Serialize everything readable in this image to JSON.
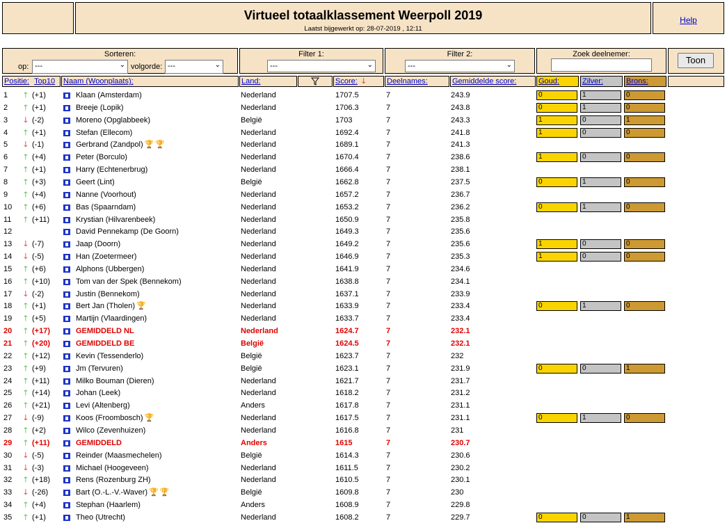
{
  "header": {
    "title": "Virtueel totaalklassement Weerpoll 2019",
    "updated": "Laatst bijgewerkt op: 28-07-2019 , 12:11",
    "help_label": "Help"
  },
  "controls": {
    "sort_label": "Sorteren:",
    "op_label": "op:",
    "op_value": "---",
    "order_label": "volgorde:",
    "order_value": "---",
    "filter1_label": "Filter 1:",
    "filter1_value": "---",
    "filter2_label": "Filter 2:",
    "filter2_value": "---",
    "search_label": "Zoek deelnemer:",
    "search_value": "",
    "show_button": "Toon"
  },
  "columns": {
    "positie": "Positie:",
    "top10": "Top10",
    "naam": "Naam (Woonplaats):",
    "land": "Land:",
    "score": "Score:",
    "deelnames": "Deelnames:",
    "gemiddelde": "Gemiddelde score:",
    "goud": "Goud:",
    "zilver": "Zilver:",
    "brons": "Brons:"
  },
  "colors": {
    "gold": "#f9d400",
    "silver": "#c4c4c4",
    "bronze": "#cc9933",
    "header_bg": "#f6e3c6",
    "up": "#1db31d",
    "down": "#e00000"
  },
  "rows": [
    {
      "pos": "1",
      "dir": "up",
      "chg": "(+1)",
      "name": "Klaan (Amsterdam)",
      "land": "Nederland",
      "score": "1707.5",
      "deel": "7",
      "avg": "243.9",
      "medals": [
        "0",
        "1",
        "0"
      ]
    },
    {
      "pos": "2",
      "dir": "up",
      "chg": "(+1)",
      "name": "Breeje (Lopik)",
      "land": "Nederland",
      "score": "1706.3",
      "deel": "7",
      "avg": "243.8",
      "medals": [
        "0",
        "1",
        "0"
      ]
    },
    {
      "pos": "3",
      "dir": "down",
      "chg": "(-2)",
      "name": "Moreno (Opglabbeek)",
      "land": "België",
      "score": "1703",
      "deel": "7",
      "avg": "243.3",
      "medals": [
        "1",
        "0",
        "1"
      ]
    },
    {
      "pos": "4",
      "dir": "up",
      "chg": "(+1)",
      "name": "Stefan (Ellecom)",
      "land": "Nederland",
      "score": "1692.4",
      "deel": "7",
      "avg": "241.8",
      "medals": [
        "1",
        "0",
        "0"
      ]
    },
    {
      "pos": "5",
      "dir": "down",
      "chg": "(-1)",
      "name": "Gerbrand (Zandpol)",
      "land": "Nederland",
      "score": "1689.1",
      "deel": "7",
      "avg": "241.3",
      "trophies": "bb"
    },
    {
      "pos": "6",
      "dir": "up",
      "chg": "(+4)",
      "name": "Peter (Borculo)",
      "land": "Nederland",
      "score": "1670.4",
      "deel": "7",
      "avg": "238.6",
      "medals": [
        "1",
        "0",
        "0"
      ]
    },
    {
      "pos": "7",
      "dir": "up",
      "chg": "(+1)",
      "name": "Harry (Echtenerbrug)",
      "land": "Nederland",
      "score": "1666.4",
      "deel": "7",
      "avg": "238.1"
    },
    {
      "pos": "8",
      "dir": "up",
      "chg": "(+3)",
      "name": "Geert (Lint)",
      "land": "België",
      "score": "1662.8",
      "deel": "7",
      "avg": "237.5",
      "medals": [
        "0",
        "1",
        "0"
      ]
    },
    {
      "pos": "9",
      "dir": "up",
      "chg": "(+4)",
      "name": "Nanne (Voorhout)",
      "land": "Nederland",
      "score": "1657.2",
      "deel": "7",
      "avg": "236.7"
    },
    {
      "pos": "10",
      "dir": "up",
      "chg": "(+6)",
      "name": "Bas (Spaarndam)",
      "land": "Nederland",
      "score": "1653.2",
      "deel": "7",
      "avg": "236.2",
      "medals": [
        "0",
        "1",
        "0"
      ]
    },
    {
      "pos": "11",
      "dir": "up",
      "chg": "(+11)",
      "name": "Krystian (Hilvarenbeek)",
      "land": "Nederland",
      "score": "1650.9",
      "deel": "7",
      "avg": "235.8"
    },
    {
      "pos": "12",
      "dir": "",
      "chg": "",
      "name": "David Pennekamp (De Goorn)",
      "land": "Nederland",
      "score": "1649.3",
      "deel": "7",
      "avg": "235.6"
    },
    {
      "pos": "13",
      "dir": "down",
      "chg": "(-7)",
      "name": "Jaap (Doorn)",
      "land": "Nederland",
      "score": "1649.2",
      "deel": "7",
      "avg": "235.6",
      "medals": [
        "1",
        "0",
        "0"
      ]
    },
    {
      "pos": "14",
      "dir": "down",
      "chg": "(-5)",
      "name": "Han (Zoetermeer)",
      "land": "Nederland",
      "score": "1646.9",
      "deel": "7",
      "avg": "235.3",
      "medals": [
        "1",
        "0",
        "0"
      ]
    },
    {
      "pos": "15",
      "dir": "up",
      "chg": "(+6)",
      "name": "Alphons (Ubbergen)",
      "land": "Nederland",
      "score": "1641.9",
      "deel": "7",
      "avg": "234.6"
    },
    {
      "pos": "16",
      "dir": "up",
      "chg": "(+10)",
      "name": "Tom van der Spek (Bennekom)",
      "land": "Nederland",
      "score": "1638.8",
      "deel": "7",
      "avg": "234.1"
    },
    {
      "pos": "17",
      "dir": "down",
      "chg": "(-2)",
      "name": "Justin (Bennekom)",
      "land": "Nederland",
      "score": "1637.1",
      "deel": "7",
      "avg": "233.9"
    },
    {
      "pos": "18",
      "dir": "up",
      "chg": "(+1)",
      "name": "Bert Jan (Tholen)",
      "land": "Nederland",
      "score": "1633.9",
      "deel": "7",
      "avg": "233.4",
      "medals": [
        "0",
        "1",
        "0"
      ],
      "trophies": "b"
    },
    {
      "pos": "19",
      "dir": "up",
      "chg": "(+5)",
      "name": "Martijn (Vlaardingen)",
      "land": "Nederland",
      "score": "1633.7",
      "deel": "7",
      "avg": "233.4"
    },
    {
      "pos": "20",
      "dir": "up",
      "chg": "(+17)",
      "name": "GEMIDDELD NL",
      "land": "Nederland",
      "score": "1624.7",
      "deel": "7",
      "avg": "232.1",
      "special": true
    },
    {
      "pos": "21",
      "dir": "up",
      "chg": "(+20)",
      "name": "GEMIDDELD BE",
      "land": "België",
      "score": "1624.5",
      "deel": "7",
      "avg": "232.1",
      "special": true
    },
    {
      "pos": "22",
      "dir": "up",
      "chg": "(+12)",
      "name": "Kevin (Tessenderlo)",
      "land": "België",
      "score": "1623.7",
      "deel": "7",
      "avg": "232"
    },
    {
      "pos": "23",
      "dir": "up",
      "chg": "(+9)",
      "name": "Jm (Tervuren)",
      "land": "België",
      "score": "1623.1",
      "deel": "7",
      "avg": "231.9",
      "medals": [
        "0",
        "0",
        "1"
      ]
    },
    {
      "pos": "24",
      "dir": "up",
      "chg": "(+11)",
      "name": "Milko Bouman (Dieren)",
      "land": "Nederland",
      "score": "1621.7",
      "deel": "7",
      "avg": "231.7"
    },
    {
      "pos": "25",
      "dir": "up",
      "chg": "(+14)",
      "name": "Johan (Leek)",
      "land": "Nederland",
      "score": "1618.2",
      "deel": "7",
      "avg": "231.2"
    },
    {
      "pos": "26",
      "dir": "up",
      "chg": "(+21)",
      "name": "Levi (Altenberg)",
      "land": "Anders",
      "score": "1617.8",
      "deel": "7",
      "avg": "231.1"
    },
    {
      "pos": "27",
      "dir": "down",
      "chg": "(-9)",
      "name": "Koos (Froombosch)",
      "land": "Nederland",
      "score": "1617.5",
      "deel": "7",
      "avg": "231.1",
      "medals": [
        "0",
        "1",
        "0"
      ],
      "trophies": "g"
    },
    {
      "pos": "28",
      "dir": "up",
      "chg": "(+2)",
      "name": "Wilco (Zevenhuizen)",
      "land": "Nederland",
      "score": "1616.8",
      "deel": "7",
      "avg": "231"
    },
    {
      "pos": "29",
      "dir": "up",
      "chg": "(+11)",
      "name": "GEMIDDELD",
      "land": "Anders",
      "score": "1615",
      "deel": "7",
      "avg": "230.7",
      "special": true
    },
    {
      "pos": "30",
      "dir": "down",
      "chg": "(-5)",
      "name": "Reinder (Maasmechelen)",
      "land": "België",
      "score": "1614.3",
      "deel": "7",
      "avg": "230.6"
    },
    {
      "pos": "31",
      "dir": "down",
      "chg": "(-3)",
      "name": "Michael (Hoogeveen)",
      "land": "Nederland",
      "score": "1611.5",
      "deel": "7",
      "avg": "230.2"
    },
    {
      "pos": "32",
      "dir": "up",
      "chg": "(+18)",
      "name": "Rens (Rozenburg ZH)",
      "land": "Nederland",
      "score": "1610.5",
      "deel": "7",
      "avg": "230.1"
    },
    {
      "pos": "33",
      "dir": "down",
      "chg": "(-26)",
      "name": "Bart (O.-L.-V.-Waver)",
      "land": "België",
      "score": "1609.8",
      "deel": "7",
      "avg": "230",
      "trophies": "gg"
    },
    {
      "pos": "34",
      "dir": "up",
      "chg": "(+4)",
      "name": "Stephan (Haarlem)",
      "land": "Anders",
      "score": "1608.9",
      "deel": "7",
      "avg": "229.8"
    },
    {
      "pos": "35",
      "dir": "up",
      "chg": "(+1)",
      "name": "Theo (Utrecht)",
      "land": "Nederland",
      "score": "1608.2",
      "deel": "7",
      "avg": "229.7",
      "medals": [
        "0",
        "0",
        "1"
      ]
    }
  ]
}
